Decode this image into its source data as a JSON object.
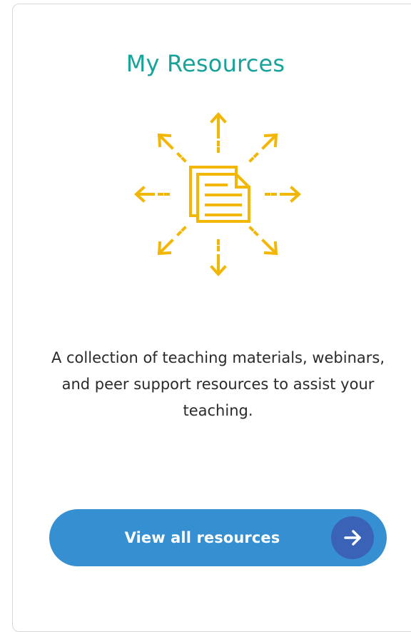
{
  "card": {
    "title": "My Resources",
    "icon": "document-share-icon",
    "description": "A collection of teaching materials, webinars, and peer support resources to assist your teaching.",
    "button": {
      "label": "View all resources",
      "icon": "arrow-right-icon"
    }
  },
  "colors": {
    "title": "#17a39a",
    "icon": "#f2b705",
    "button": "#368fd1",
    "button_arrow_circle": "#3a63b7"
  }
}
